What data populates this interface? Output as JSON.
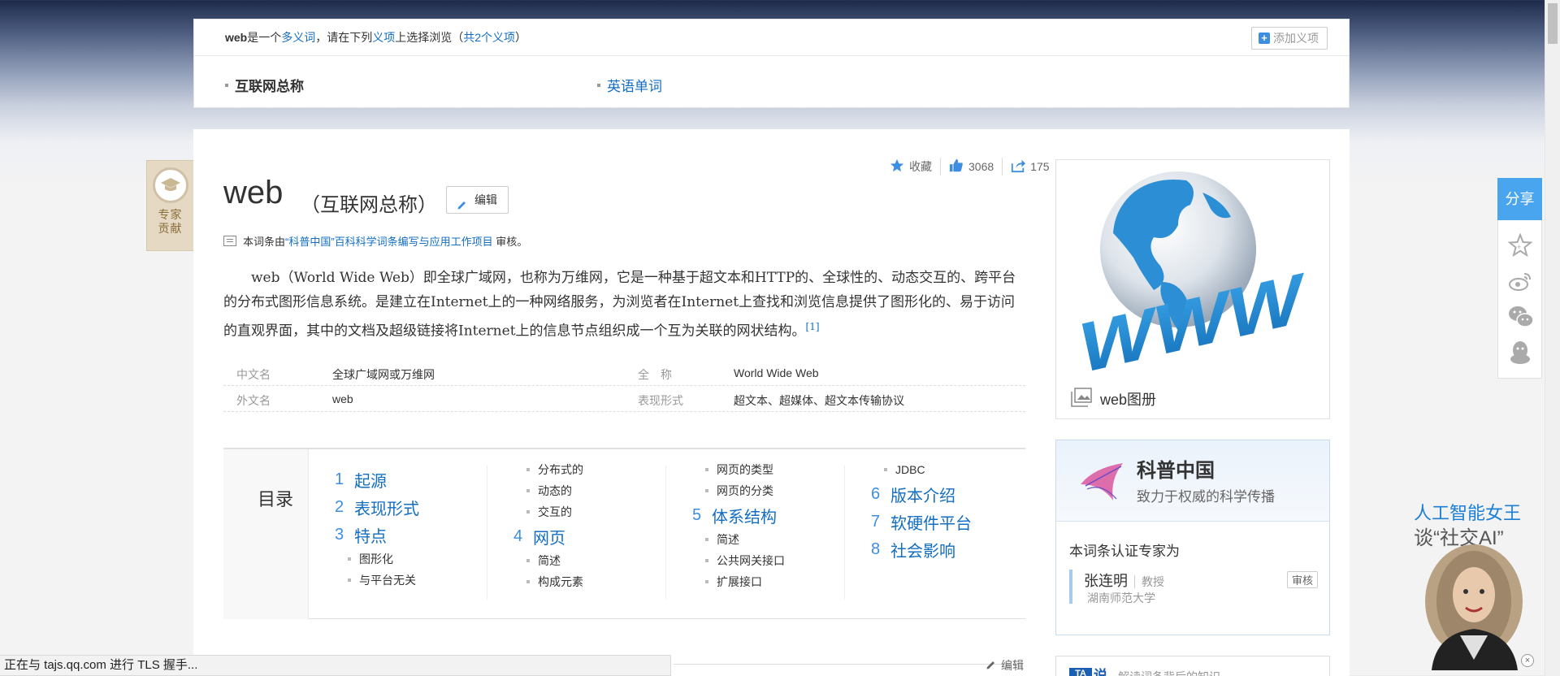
{
  "disambig": {
    "prefix_word": "web",
    "prefix_text": "是一个",
    "polysemy_link": "多义词",
    "mid_text": "，请在下列",
    "sense_link": "义项",
    "tail_text": "上选择浏览（",
    "count_link": "共2个义项",
    "close_paren": "）",
    "add_sense": "添加义项",
    "senses": [
      "互联网总称",
      "英语单词"
    ]
  },
  "expert_badge": "专家贡献",
  "lemma": {
    "title": "web",
    "subtitle": "（互联网总称）",
    "edit_label": "编辑"
  },
  "actions": {
    "collect": "收藏",
    "likes": "3068",
    "shares": "175"
  },
  "review": {
    "pre": "本词条由",
    "link": "“科普中国”百科科学词条编写与应用工作项目",
    "post": " 审核。"
  },
  "summary": "web（World Wide Web）即全球广域网，也称为万维网，它是一种基于超文本和HTTP的、全球性的、动态交互的、跨平台的分布式图形信息系统。是建立在Internet上的一种网络服务，为浏览者在Internet上查找和浏览信息提供了图形化的、易于访问的直观界面，其中的文档及超级链接将Internet上的信息节点组织成一个互为关联的网状结构。",
  "summary_ref": "[1]",
  "basic_info": [
    {
      "n1": "中文名",
      "v1": "全球广域网或万维网",
      "n2": "全　称",
      "v2": "World Wide Web"
    },
    {
      "n1": "外文名",
      "v1": "web",
      "n2": "表现形式",
      "v2": "超文本、超媒体、超文本传输协议"
    }
  ],
  "catalog": {
    "heading": "目录",
    "col1": [
      {
        "type": "l1",
        "num": "1",
        "text": "起源"
      },
      {
        "type": "l1",
        "num": "2",
        "text": "表现形式"
      },
      {
        "type": "l1",
        "num": "3",
        "text": "特点"
      },
      {
        "type": "l2",
        "text": "图形化"
      },
      {
        "type": "l2",
        "text": "与平台无关"
      }
    ],
    "col2": [
      {
        "type": "l2",
        "text": "分布式的"
      },
      {
        "type": "l2",
        "text": "动态的"
      },
      {
        "type": "l2",
        "text": "交互的"
      },
      {
        "type": "l1",
        "num": "4",
        "text": "网页"
      },
      {
        "type": "l2",
        "text": "简述"
      },
      {
        "type": "l2",
        "text": "构成元素"
      }
    ],
    "col3": [
      {
        "type": "l2",
        "text": "网页的类型"
      },
      {
        "type": "l2",
        "text": "网页的分类"
      },
      {
        "type": "l1",
        "num": "5",
        "text": "体系结构"
      },
      {
        "type": "l2",
        "text": "简述"
      },
      {
        "type": "l2",
        "text": "公共网关接口"
      },
      {
        "type": "l2",
        "text": "扩展接口"
      }
    ],
    "col4": [
      {
        "type": "l2",
        "text": "JDBC"
      },
      {
        "type": "l1",
        "num": "6",
        "text": "版本介绍"
      },
      {
        "type": "l1",
        "num": "7",
        "text": "软硬件平台"
      },
      {
        "type": "l1",
        "num": "8",
        "text": "社会影响"
      }
    ]
  },
  "section_edit": "编辑",
  "album": {
    "label": "web图册",
    "image_text": "WWW"
  },
  "kepu": {
    "name": "科普中国",
    "slogan": "致力于权威的科学传播",
    "cert_label": "本词条认证专家为",
    "expert_name": "张连明",
    "expert_title": "教授",
    "expert_org": "湖南师范大学",
    "expert_tag": "审核"
  },
  "ta_card": {
    "logo": "TA",
    "logo_tail": "说",
    "text": "解读词条背后的知识"
  },
  "share": {
    "label": "分享"
  },
  "ad": {
    "line1": "人工智能女王",
    "line2": "谈“社交AI”",
    "close": "×"
  },
  "status_text": "正在与 tajs.qq.com 进行 TLS 握手..."
}
